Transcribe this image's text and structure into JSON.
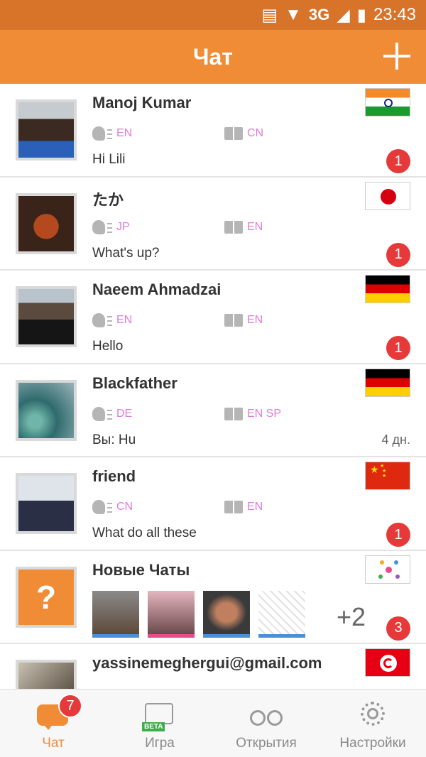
{
  "status": {
    "network": "3G",
    "time": "23:43"
  },
  "header": {
    "title": "Чат"
  },
  "chats": [
    {
      "name": "Manoj Kumar",
      "speaks": "EN",
      "learns": "CN",
      "message": "Hi Lili",
      "badge": "1",
      "flag": "india"
    },
    {
      "name": "たか",
      "speaks": "JP",
      "learns": "EN",
      "message": "What's up?",
      "badge": "1",
      "flag": "japan"
    },
    {
      "name": "Naeem Ahmadzai",
      "speaks": "EN",
      "learns": "EN",
      "message": "Hello",
      "badge": "1",
      "flag": "germany"
    },
    {
      "name": "Blackfather",
      "speaks": "DE",
      "learns": "EN SP",
      "message": "Вы: Hu",
      "time": "4 дн.",
      "flag": "germany"
    },
    {
      "name": "friend",
      "speaks": "CN",
      "learns": "EN",
      "message": "What do all these",
      "badge": "1",
      "flag": "china"
    }
  ],
  "new_chats": {
    "name": "Новые Чаты",
    "more": "+2",
    "badge": "3"
  },
  "last_chat": {
    "name": "yassinemeghergui@gmail.com",
    "flag": "tunisia"
  },
  "tabs": [
    {
      "label": "Чат",
      "badge": "7",
      "icon": "chat-bubble-icon"
    },
    {
      "label": "Игра",
      "beta": "BETA",
      "icon": "puzzle-icon"
    },
    {
      "label": "Открытия",
      "icon": "binoculars-icon"
    },
    {
      "label": "Настройки",
      "icon": "gear-icon"
    }
  ],
  "colors": {
    "accent": "#f08c36",
    "status_bar": "#d7742a",
    "badge": "#e5393a",
    "lang_text": "#e07bd8"
  }
}
